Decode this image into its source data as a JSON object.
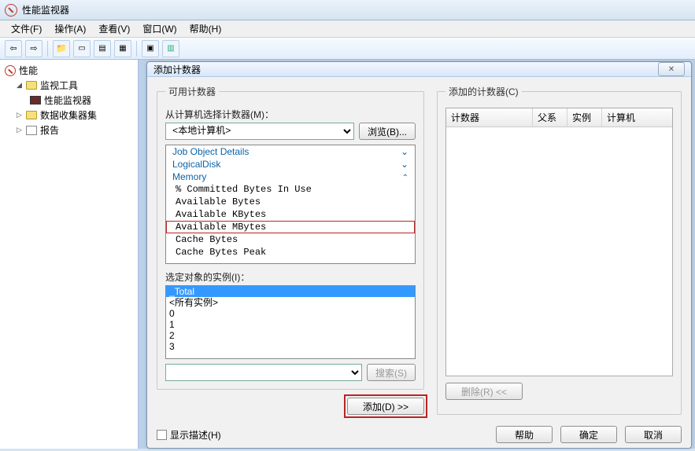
{
  "window": {
    "title": "性能监视器"
  },
  "menu": {
    "file": "文件(F)",
    "action": "操作(A)",
    "view": "查看(V)",
    "window": "窗口(W)",
    "help": "帮助(H)"
  },
  "tree": {
    "root": "性能",
    "monTools": "监视工具",
    "perfMon": "性能监视器",
    "collectors": "数据收集器集",
    "reports": "报告"
  },
  "dialog": {
    "title": "添加计数器",
    "available_group": "可用计数器",
    "from_label": "从计算机选择计数器(M)：",
    "computer": "<本地计算机>",
    "browse": "浏览(B)...",
    "categories": [
      {
        "name": "Job Object Details",
        "expanded": false,
        "cut": true
      },
      {
        "name": "LogicalDisk",
        "expanded": false
      },
      {
        "name": "Memory",
        "expanded": true
      }
    ],
    "counters": [
      "% Committed Bytes In Use",
      "Available Bytes",
      "Available KBytes",
      "Available MBytes",
      "Cache Bytes",
      "Cache Bytes Peak"
    ],
    "highlighted_counter": "Available MBytes",
    "instances_label": "选定对象的实例(I)：",
    "instances": [
      "_Total",
      "<所有实例>",
      "0",
      "1",
      "2",
      "3"
    ],
    "instance_selected": "_Total",
    "search": "搜索(S)",
    "add": "添加(D) >>",
    "added_group": "添加的计数器(C)",
    "cols": {
      "counter": "计数器",
      "parent": "父系",
      "inst": "实例",
      "computer": "计算机"
    },
    "remove": "删除(R) <<",
    "show_desc": "显示描述(H)",
    "help": "帮助",
    "ok": "确定",
    "cancel": "取消"
  }
}
